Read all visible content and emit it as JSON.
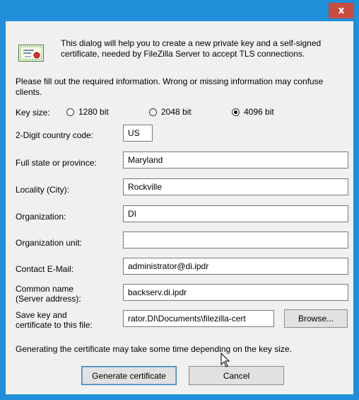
{
  "window": {
    "close_glyph": "x"
  },
  "intro": "This dialog will help you to create a new private key and a self-signed certificate, needed by FileZilla Server to accept TLS connections.",
  "fill_info": "Please fill out the required information. Wrong or missing information may confuse clients.",
  "key_size": {
    "label": "Key size:",
    "options": [
      {
        "label": "1280 bit",
        "selected": false
      },
      {
        "label": "2048 bit",
        "selected": false
      },
      {
        "label": "4096 bit",
        "selected": true
      }
    ]
  },
  "fields": {
    "country": {
      "label": "2-Digit country code:",
      "value": "US"
    },
    "state": {
      "label": "Full state or province:",
      "value": "Maryland"
    },
    "locality": {
      "label": "Locality (City):",
      "value": "Rockville"
    },
    "organization": {
      "label": "Organization:",
      "value": "DI"
    },
    "org_unit": {
      "label": "Organization unit:",
      "value": ""
    },
    "email": {
      "label": "Contact E-Mail:",
      "value": "administrator@di.ipdr"
    },
    "common_name": {
      "label_line1": "Common name",
      "label_line2": "(Server address):",
      "value": "backserv.di.ipdr"
    },
    "save_path": {
      "label_line1": "Save key and",
      "label_line2": "certificate to this file:",
      "value": "rator.DI\\Documents\\filezilla-cert"
    }
  },
  "browse_label": "Browse...",
  "note": "Generating the certificate may take some time depending on the key size.",
  "generate_label": "Generate certificate",
  "cancel_label": "Cancel",
  "colors": {
    "title_bar": "#1e8fd8",
    "close_button": "#c94c40",
    "client_bg": "#f0f0f0"
  }
}
